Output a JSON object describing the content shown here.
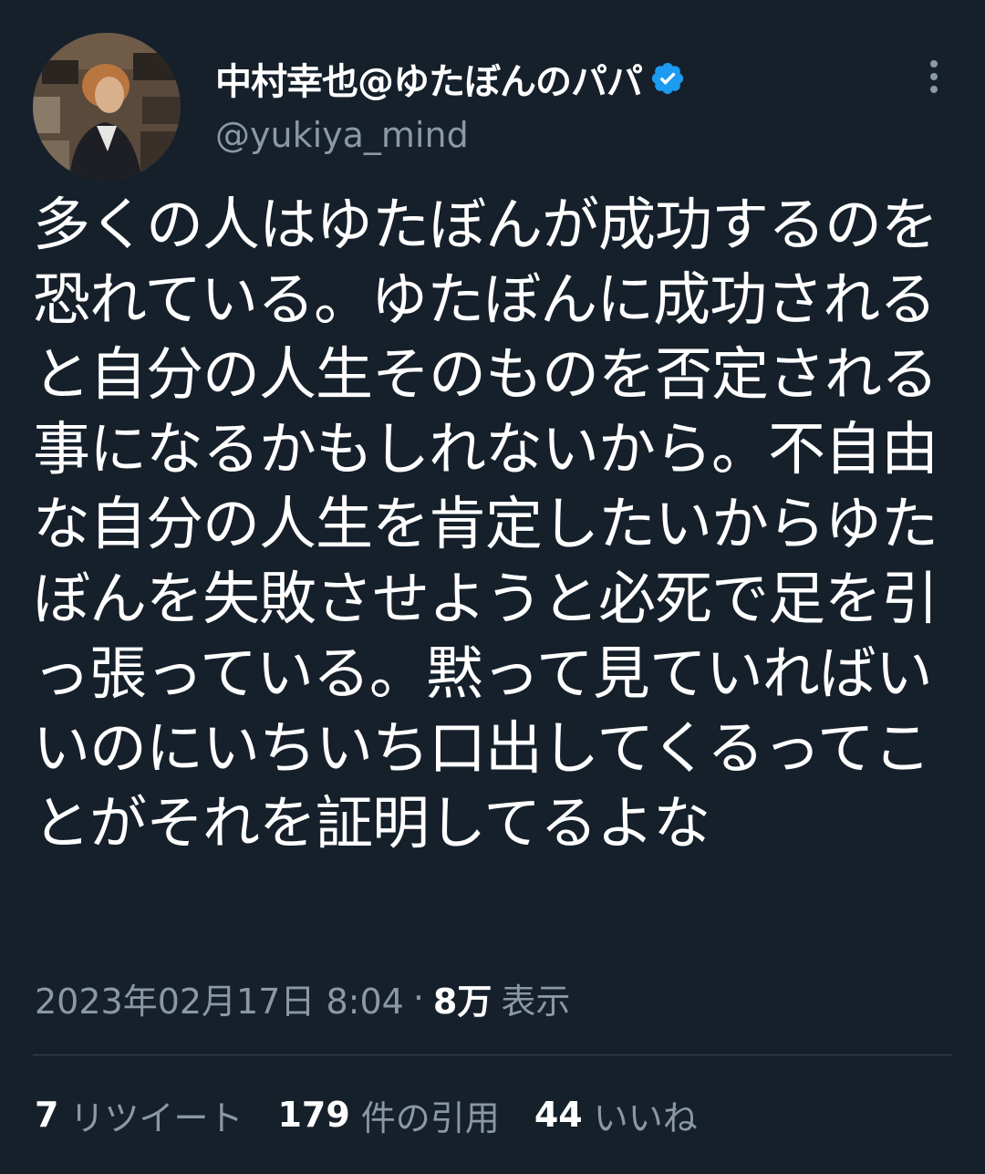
{
  "author": {
    "name": "中村幸也@ゆたぼんのパパ",
    "handle": "@yukiya_mind",
    "verified": true,
    "verified_color": "#1d9bf0"
  },
  "tweet": {
    "text": "多くの人はゆたぼんが成功するのを恐れている。ゆたぼんに成功されると自分の人生そのものを否定される事になるかもしれないから。不自由な自分の人生を肯定したいからゆたぼんを失敗させようと必死で足を引っ張っている。黙って見ていればいいのにいちいち口出してくるってことがそれを証明してるよな",
    "timestamp": "2023年02月17日 8:04",
    "separator": "·",
    "views_count": "8万",
    "views_label": "表示"
  },
  "stats": {
    "retweets_count": "7",
    "retweets_label": "リツイート",
    "quotes_count": "179",
    "quotes_label": "件の引用",
    "likes_count": "44",
    "likes_label": "いいね"
  },
  "colors": {
    "background": "#15202b",
    "text_primary": "#ffffff",
    "text_secondary": "#8b98a5",
    "divider": "#38444d"
  },
  "icons": {
    "verified": "verified-badge-icon",
    "more": "more-options-icon"
  }
}
